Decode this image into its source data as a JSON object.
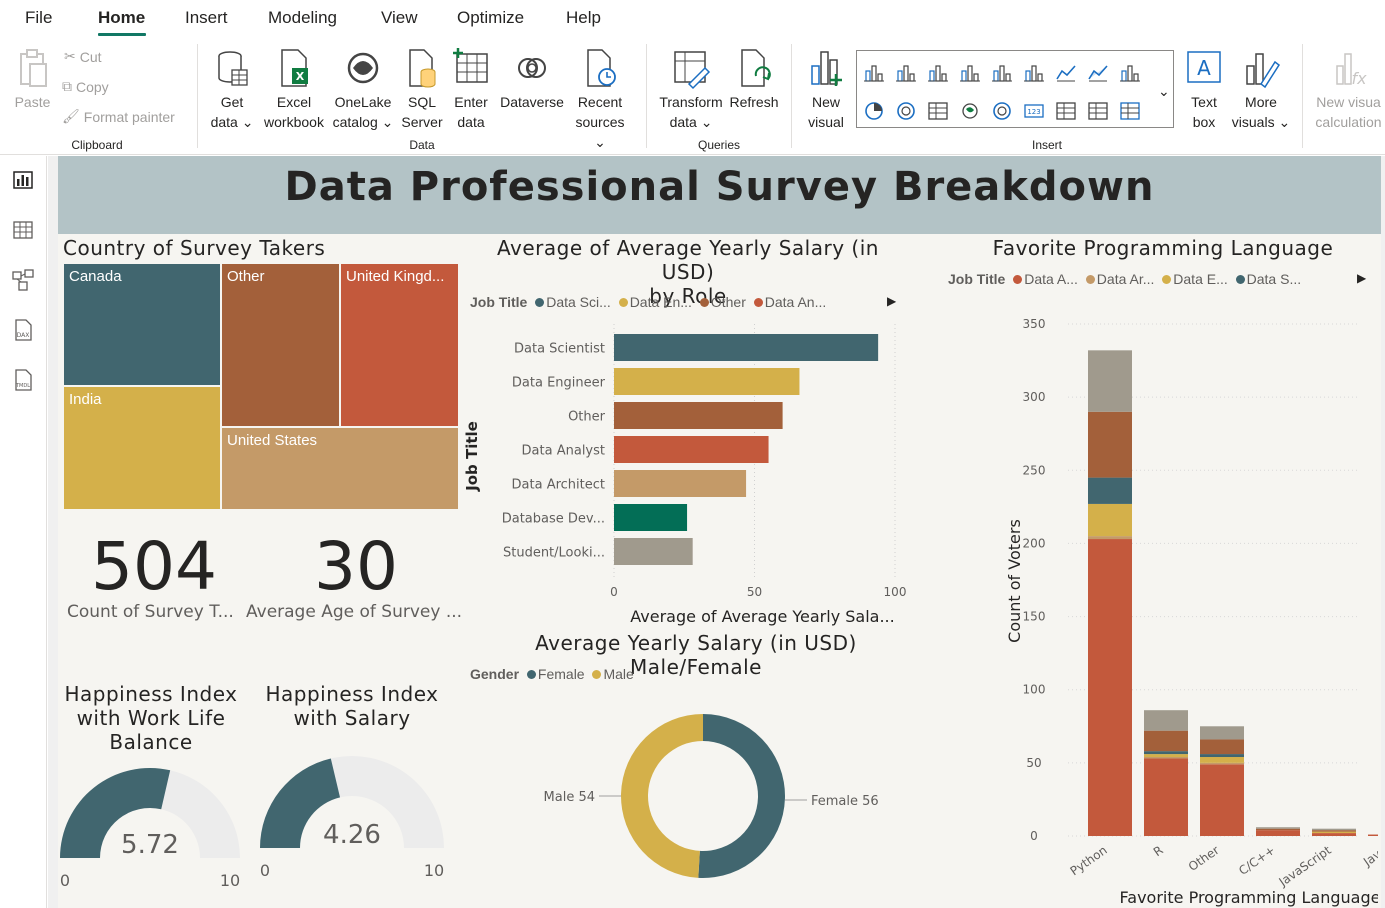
{
  "menu": {
    "items": [
      "File",
      "Home",
      "Insert",
      "Modeling",
      "View",
      "Optimize",
      "Help"
    ],
    "active": "Home"
  },
  "ribbon": {
    "clipboard": {
      "paste": "Paste",
      "cut": "Cut",
      "copy": "Copy",
      "format_painter": "Format painter",
      "group": "Clipboard"
    },
    "data": {
      "get_data": [
        "Get",
        "data"
      ],
      "excel": [
        "Excel",
        "workbook"
      ],
      "onelake": [
        "OneLake",
        "catalog"
      ],
      "sql": [
        "SQL",
        "Server"
      ],
      "enter": [
        "Enter",
        "data"
      ],
      "dataverse": "Dataverse",
      "recent": [
        "Recent",
        "sources"
      ],
      "group": "Data"
    },
    "queries": {
      "transform": [
        "Transform",
        "data"
      ],
      "refresh": "Refresh",
      "group": "Queries"
    },
    "insert": {
      "new_visual": [
        "New",
        "visual"
      ],
      "text_box": [
        "Text",
        "box"
      ],
      "more_visuals": [
        "More",
        "visuals"
      ],
      "group": "Insert"
    },
    "calc": {
      "new_visual_calc": [
        "New visua",
        "calculation"
      ]
    }
  },
  "report": {
    "title": "Data Professional Survey Breakdown",
    "treemap": {
      "title": "Country of Survey Takers",
      "cells": [
        {
          "label": "Canada",
          "color": "#41666f"
        },
        {
          "label": "Other",
          "color": "#a3603a"
        },
        {
          "label": "United Kingd...",
          "color": "#c3593c"
        },
        {
          "label": "India",
          "color": "#d4b04a"
        },
        {
          "label": "United States",
          "color": "#c49a68"
        }
      ]
    },
    "card_count": {
      "value": "504",
      "label": "Count of Survey T..."
    },
    "card_age": {
      "value": "30",
      "label": "Average Age of Survey ..."
    },
    "gauge_work": {
      "title": [
        "Happiness Index",
        "with Work Life",
        "Balance"
      ],
      "value": 5.72,
      "value_text": "5.72",
      "min": "0",
      "max": "10"
    },
    "gauge_salary": {
      "title": [
        "Happiness Index",
        "with Salary"
      ],
      "value": 4.26,
      "value_text": "4.26",
      "min": "0",
      "max": "10"
    },
    "bar": {
      "title": [
        "Average of Average Yearly Salary (in USD)",
        "by Role"
      ],
      "legend_title": "Job Title",
      "legend": [
        {
          "label": "Data Sci...",
          "color": "#41666f"
        },
        {
          "label": "Data En...",
          "color": "#d4b04a"
        },
        {
          "label": "Other",
          "color": "#a3603a"
        },
        {
          "label": "Data An...",
          "color": "#c3593c"
        }
      ],
      "y_title": "Job Title",
      "x_title": "Average of Average Yearly Sala..."
    },
    "donut": {
      "title": "Average Yearly Salary (in USD) Male/Female",
      "legend_title": "Gender",
      "legend": [
        {
          "label": "Female",
          "color": "#41666f"
        },
        {
          "label": "Male",
          "color": "#d4b04a"
        }
      ]
    },
    "stacked": {
      "title": "Favorite Programming Language",
      "legend_title": "Job Title",
      "legend": [
        {
          "label": "Data A...",
          "color": "#c3593c"
        },
        {
          "label": "Data Ar...",
          "color": "#c49a68"
        },
        {
          "label": "Data E...",
          "color": "#d4b04a"
        },
        {
          "label": "Data S...",
          "color": "#41666f"
        }
      ],
      "y_title": "Count of Voters",
      "x_title": "Favorite Programming Language"
    }
  },
  "chart_data": [
    {
      "type": "treemap",
      "title": "Country of Survey Takers",
      "categories": [
        "Canada",
        "Other",
        "United Kingd...",
        "India",
        "United States"
      ]
    },
    {
      "type": "bar",
      "title": "Average of Average Yearly Salary (in USD) by Role",
      "categories": [
        "Data Scientist",
        "Data Engineer",
        "Other",
        "Data Analyst",
        "Data Architect",
        "Database Dev...",
        "Student/Looki..."
      ],
      "values": [
        94,
        66,
        60,
        55,
        47,
        26,
        28
      ],
      "colors": [
        "#41666f",
        "#d4b04a",
        "#a3603a",
        "#c3593c",
        "#c49a68",
        "#036e56",
        "#a09a8d"
      ],
      "xlim": [
        0,
        100
      ],
      "xticks": [
        "0",
        "50",
        "100"
      ],
      "ylabel": "Job Title",
      "xlabel": "Average of Average Yearly Sala...",
      "legend_position": "top"
    },
    {
      "type": "pie",
      "title": "Average Yearly Salary (in USD) Male/Female",
      "categories": [
        "Female",
        "Male"
      ],
      "values": [
        56,
        54
      ],
      "data_labels": [
        "Female 56",
        "Male 54"
      ],
      "colors": [
        "#41666f",
        "#d4b04a"
      ],
      "donut": true
    },
    {
      "type": "bar",
      "stacked": true,
      "title": "Favorite Programming Language",
      "categories": [
        "Python",
        "R",
        "Other",
        "C/C++",
        "JavaScript",
        "Java"
      ],
      "series": [
        {
          "name": "Data A...",
          "color": "#c3593c",
          "values": [
            203,
            53,
            49,
            4,
            2,
            1
          ]
        },
        {
          "name": "Data Ar...",
          "color": "#c49a68",
          "values": [
            2,
            1,
            1,
            0,
            0,
            0
          ]
        },
        {
          "name": "Data E...",
          "color": "#d4b04a",
          "values": [
            22,
            2,
            4,
            0,
            1,
            0
          ]
        },
        {
          "name": "Data S...",
          "color": "#41666f",
          "values": [
            18,
            2,
            2,
            0,
            0,
            0
          ]
        },
        {
          "color": "#a3603a",
          "values": [
            45,
            14,
            10,
            1,
            1,
            0
          ]
        },
        {
          "color": "#a09a8d",
          "values": [
            42,
            14,
            9,
            1,
            1,
            0
          ]
        }
      ],
      "ylim": [
        0,
        350
      ],
      "yticks": [
        "0",
        "50",
        "100",
        "150",
        "200",
        "250",
        "300",
        "350"
      ],
      "ylabel": "Count of Voters",
      "xlabel": "Favorite Programming Language",
      "legend_position": "top"
    }
  ]
}
